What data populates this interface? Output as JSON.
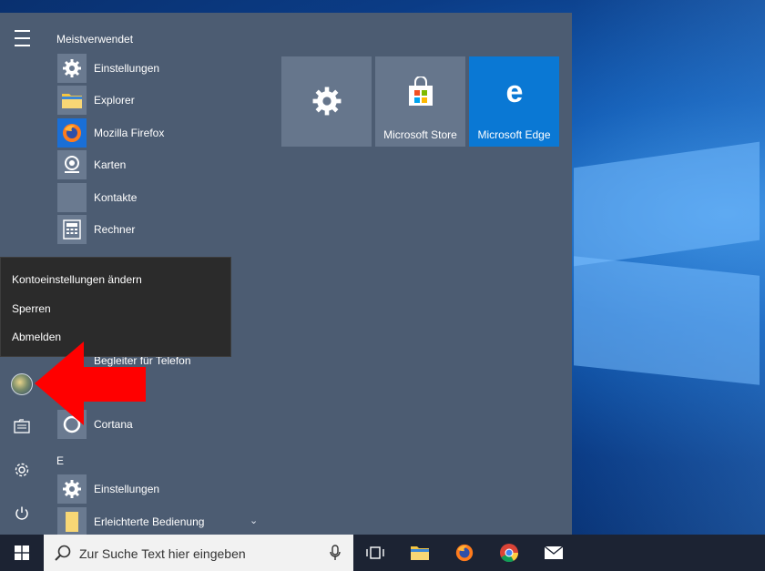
{
  "start_menu": {
    "most_used_heading": "Meistverwendet",
    "most_used": [
      {
        "label": "Einstellungen",
        "icon": "gear-icon"
      },
      {
        "label": "Explorer",
        "icon": "folder-icon"
      },
      {
        "label": "Mozilla Firefox",
        "icon": "firefox-icon"
      },
      {
        "label": "Karten",
        "icon": "maps-icon"
      },
      {
        "label": "Kontakte",
        "icon": "contacts-icon"
      },
      {
        "label": "Rechner",
        "icon": "calculator-icon"
      }
    ],
    "partial_item": "Begleiter für Telefon",
    "cortana": "Cortana",
    "section_e": "E",
    "e_items": [
      {
        "label": "Einstellungen",
        "icon": "gear-icon"
      },
      {
        "label": "Erleichterte Bedienung",
        "icon": "folder-icon"
      }
    ],
    "tiles": [
      {
        "label": "",
        "icon": "gear-icon",
        "color": "#66768c"
      },
      {
        "label": "Microsoft Store",
        "icon": "store-icon",
        "color": "#66768c"
      },
      {
        "label": "Microsoft Edge",
        "icon": "edge-icon",
        "color": "#0a78d4"
      }
    ]
  },
  "account_menu": {
    "items": [
      "Kontoeinstellungen ändern",
      "Sperren",
      "Abmelden"
    ]
  },
  "taskbar": {
    "search_placeholder": "Zur Suche Text hier eingeben",
    "icons": [
      "task-view-icon",
      "file-explorer-icon",
      "firefox-icon",
      "chrome-icon",
      "mail-icon"
    ]
  },
  "colors": {
    "start_bg": "#4c5c72",
    "accent": "#0a78d4",
    "arrow": "#ff0000",
    "popup_bg": "#2b2b2b",
    "taskbar_bg": "#1c2333"
  }
}
